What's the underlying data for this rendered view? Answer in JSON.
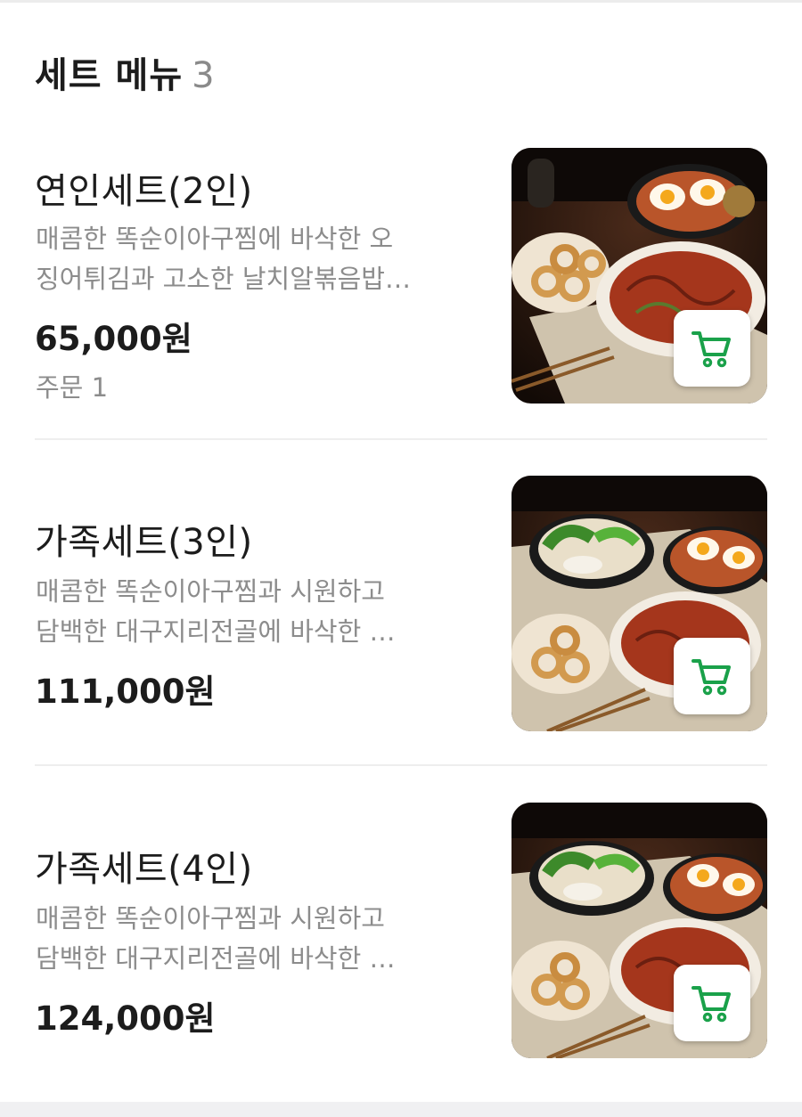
{
  "section": {
    "title": "세트 메뉴",
    "count": "3"
  },
  "items": [
    {
      "name": "연인세트(2인)",
      "desc_line1": "매콤한 똑순이아구찜에 바삭한 오",
      "desc_line2": "징어튀김과 고소한 날치알볶음밥…",
      "price": "65,000원",
      "orders": "주문 1",
      "image": "couple-set-food-photo",
      "cart_icon": "cart-icon"
    },
    {
      "name": "가족세트(3인)",
      "desc_line1": "매콤한 똑순이아구찜과 시원하고",
      "desc_line2": "담백한 대구지리전골에 바삭한 …",
      "price": "111,000원",
      "image": "family-set-3-food-photo",
      "cart_icon": "cart-icon"
    },
    {
      "name": "가족세트(4인)",
      "desc_line1": "매콤한 똑순이아구찜과 시원하고",
      "desc_line2": "담백한 대구지리전골에 바삭한 …",
      "price": "124,000원",
      "image": "family-set-4-food-photo",
      "cart_icon": "cart-icon"
    }
  ],
  "colors": {
    "accent": "#1aa14a",
    "muted": "#8c8c8c",
    "text": "#1c1c1c"
  }
}
